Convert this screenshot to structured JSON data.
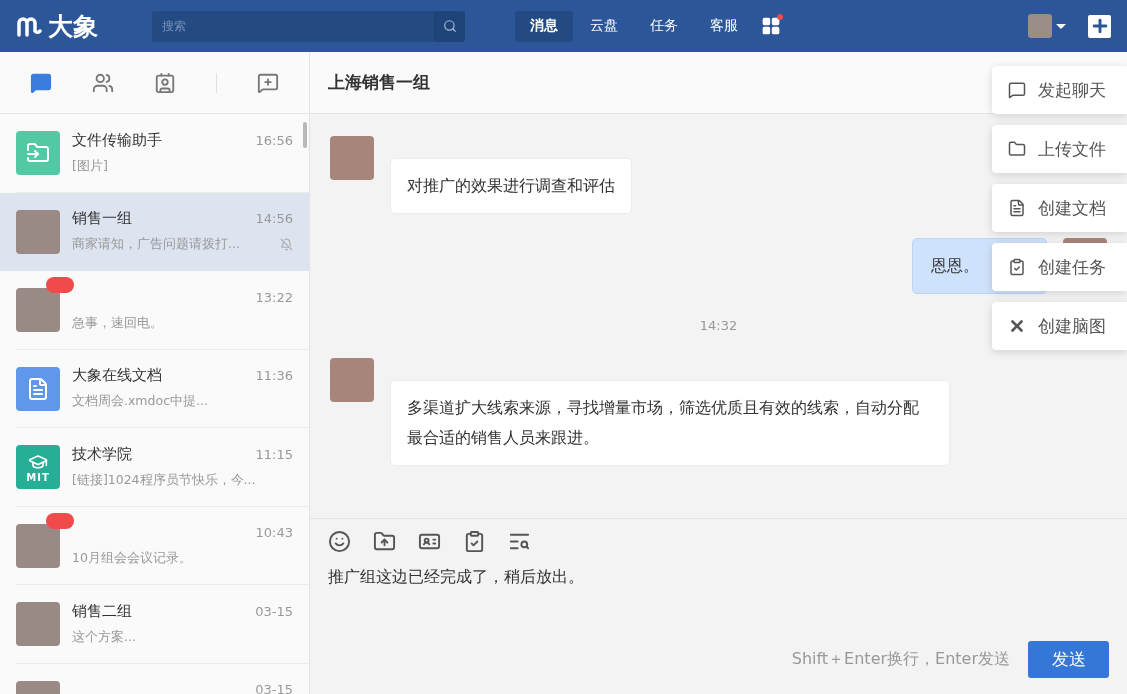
{
  "app": {
    "name": "大象"
  },
  "search": {
    "placeholder": "搜索"
  },
  "nav": [
    {
      "label": "消息",
      "selected": true
    },
    {
      "label": "云盘",
      "selected": false
    },
    {
      "label": "任务",
      "selected": false
    },
    {
      "label": "客服",
      "selected": false
    }
  ],
  "apps_unread": true,
  "sidebar_tabs": [
    {
      "kind": "chats",
      "selected": true
    },
    {
      "kind": "groups",
      "selected": false
    },
    {
      "kind": "contacts",
      "selected": false
    },
    {
      "kind": "new-chat",
      "selected": false
    }
  ],
  "conversations": [
    {
      "kind": "file-transfer",
      "name": "文件传输助手",
      "time": "16:56",
      "preview": "[图片]",
      "selected": false,
      "unread": false,
      "muted": false
    },
    {
      "kind": "photo",
      "name": "销售一组",
      "time": "14:56",
      "preview": "商家请知，广告问题请拨打...",
      "selected": true,
      "unread": false,
      "muted": true
    },
    {
      "kind": "photo",
      "time": "13:22",
      "preview": "急事，速回电。",
      "selected": false,
      "unread": true,
      "muted": false
    },
    {
      "kind": "doc",
      "name": "大象在线文档",
      "time": "11:36",
      "preview": "文档周会.xmdoc中提...",
      "selected": false,
      "unread": false,
      "muted": false
    },
    {
      "kind": "academy",
      "avatar_text": "MIT",
      "name": "技术学院",
      "time": "11:15",
      "preview": "[链接]1024程序员节快乐，今...",
      "selected": false,
      "unread": false,
      "muted": false
    },
    {
      "kind": "photo",
      "time": "10:43",
      "preview": "10月组会会议记录。",
      "selected": false,
      "unread": true,
      "muted": false
    },
    {
      "kind": "photo",
      "name": "销售二组",
      "time": "03-15",
      "preview": "这个方案...",
      "selected": false,
      "unread": false,
      "muted": false
    },
    {
      "kind": "photo",
      "time": "03-15",
      "selected": false,
      "unread": false,
      "muted": false
    }
  ],
  "chat": {
    "title": "上海销售一组",
    "messages": [
      {
        "kind": "incoming",
        "text": "对推广的效果进行调查和评估"
      },
      {
        "kind": "outgoing",
        "text": "恩恩。"
      },
      {
        "kind": "time",
        "text": "14:32"
      },
      {
        "kind": "incoming",
        "text": "多渠道扩大线索来源，寻找增量市场，筛选优质且有效的线索，自动分配最合适的销售人员来跟进。"
      }
    ],
    "draft": "推广组这边已经完成了，稍后放出。",
    "hint": "Shift＋Enter换行，Enter发送",
    "send": "发送"
  },
  "menu": [
    {
      "kind": "chat",
      "label": "发起聊天"
    },
    {
      "kind": "upload",
      "label": "上传文件"
    },
    {
      "kind": "doc",
      "label": "创建文档"
    },
    {
      "kind": "task",
      "label": "创建任务"
    },
    {
      "kind": "mindmap",
      "label": "创建脑图"
    }
  ]
}
